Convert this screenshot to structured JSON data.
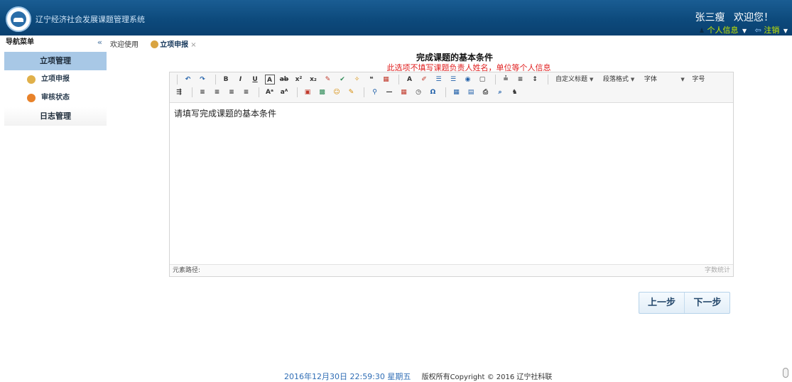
{
  "header": {
    "app_title": "辽宁经济社会发展课题管理系统",
    "user_name": "张三瘦",
    "welcome": "欢迎您！",
    "profile_link": "个人信息",
    "logout_link": "注销"
  },
  "sidebar": {
    "title": "导航菜单",
    "collapse_glyph": "«",
    "group_label": "立项管理",
    "items": [
      {
        "label": "立项申报",
        "icon": "gear-icon",
        "color": "#e0b04a"
      },
      {
        "label": "审核状态",
        "icon": "flower-icon",
        "color": "#e8822a"
      }
    ],
    "group2_label": "日志管理"
  },
  "tabs": [
    {
      "label": "欢迎使用"
    },
    {
      "label": "立项申报",
      "close": "×"
    }
  ],
  "form": {
    "title": "完成课题的基本条件",
    "note": "此选项不填写课题负责人姓名，单位等个人信息"
  },
  "editor": {
    "content": "请填写完成课题的基本条件",
    "status_label": "元素路径:",
    "word_count_label": "字数统计",
    "selects": {
      "heading": "自定义标题",
      "paragraph": "段落格式",
      "font": "字体",
      "size": "字号"
    }
  },
  "buttons": {
    "prev": "上一步",
    "next": "下一步"
  },
  "footer": {
    "datetime": "2016年12月30日 22:59:30 星期五",
    "copyright": "版权所有Copyright © 2016 辽宁社科联"
  },
  "colors": {
    "header_bg": "#0d4a7c",
    "accent_green": "#c8e800",
    "note_red": "#e02020",
    "sidebar_active": "#a8c8e6"
  }
}
